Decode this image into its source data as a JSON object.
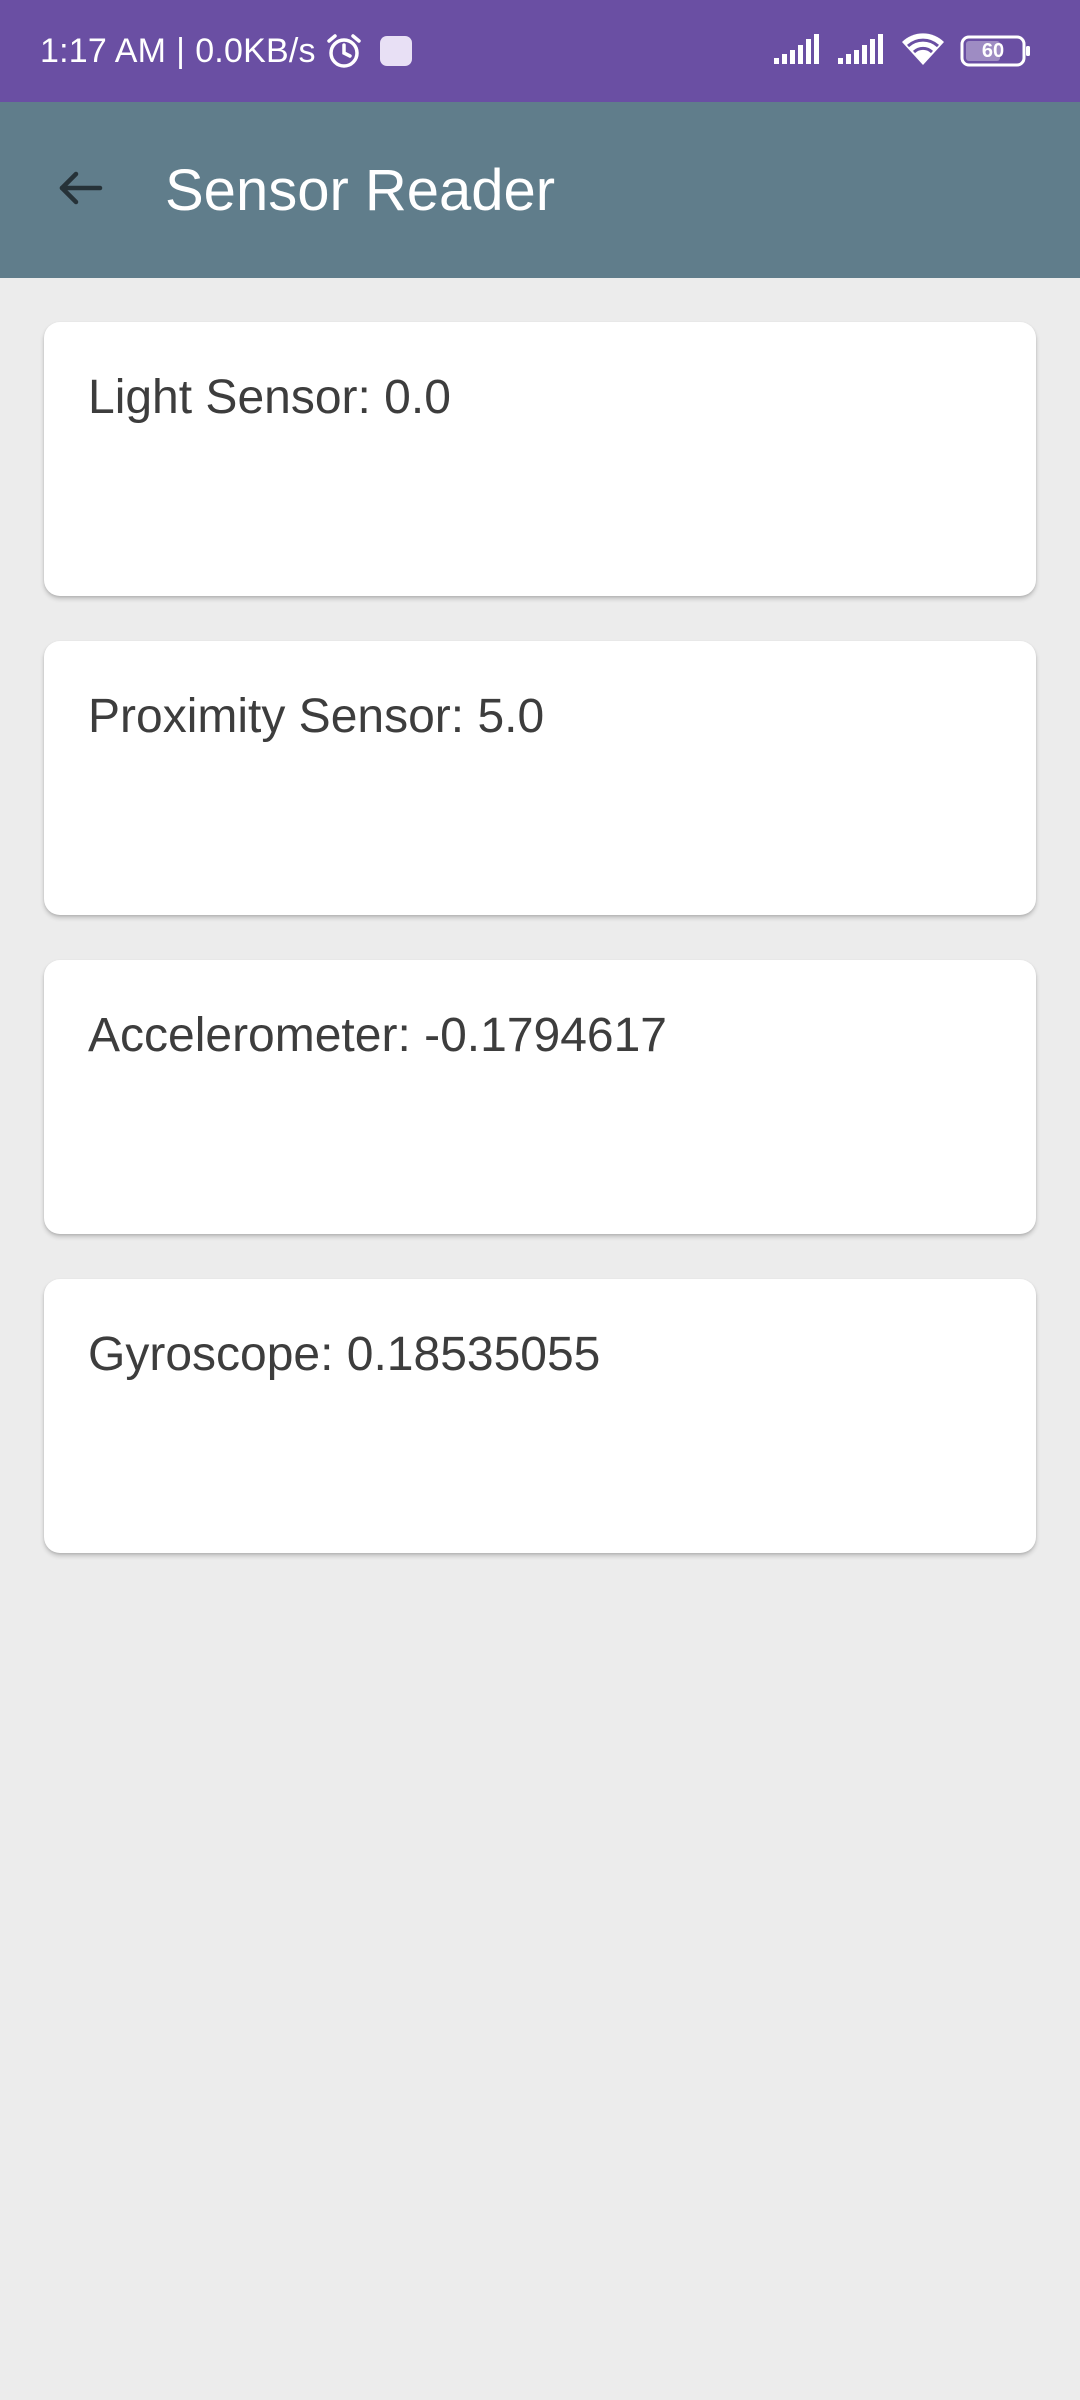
{
  "status_bar": {
    "time": "1:17 AM",
    "separator": "|",
    "network_speed": "0.0KB/s",
    "battery_level": "60",
    "icons": [
      "alarm-icon",
      "notification-icon",
      "signal-icon",
      "signal-icon",
      "wifi-icon",
      "battery-icon"
    ],
    "background_color": "#6a4fa3"
  },
  "app_bar": {
    "title": "Sensor Reader",
    "back_icon": "arrow-back-icon",
    "background_color": "#607d8b"
  },
  "sensors": [
    {
      "label": "Light Sensor: 0.0"
    },
    {
      "label": "Proximity Sensor: 5.0"
    },
    {
      "label": "Accelerometer: -0.1794617"
    },
    {
      "label": "Gyroscope: 0.18535055"
    }
  ],
  "theme": {
    "page_background": "#ececec",
    "card_background": "#ffffff",
    "text_color": "#3d3d3d"
  }
}
